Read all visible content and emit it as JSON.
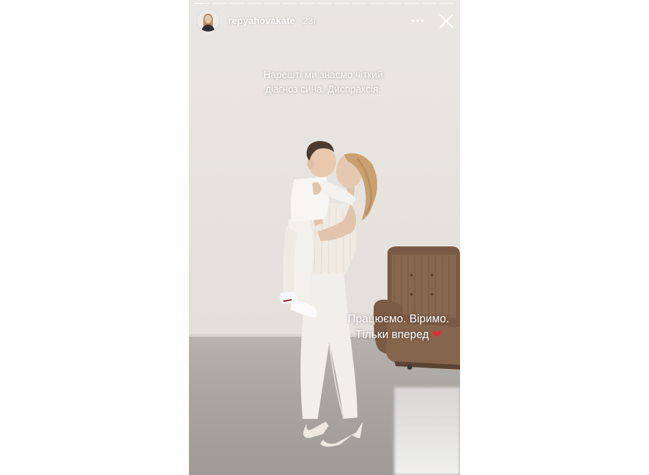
{
  "story": {
    "progress": {
      "total": 15,
      "completed": 1,
      "current_fraction": 0.5
    },
    "header": {
      "username": "repyahovakate",
      "time_ago": "23г",
      "more_icon": "more-horizontal-icon",
      "close_icon": "close-icon"
    },
    "captions": {
      "top_line1": "Нарешті ми знаємо чіткий",
      "top_line2": "діагноз сина. Диспраксія.",
      "bottom_line1": "Працюємо. Віримо.",
      "bottom_line2": "Тільки вперед",
      "bottom_emoji": "❤"
    },
    "colors": {
      "heart": "#e8283a",
      "text": "#ffffff"
    }
  }
}
